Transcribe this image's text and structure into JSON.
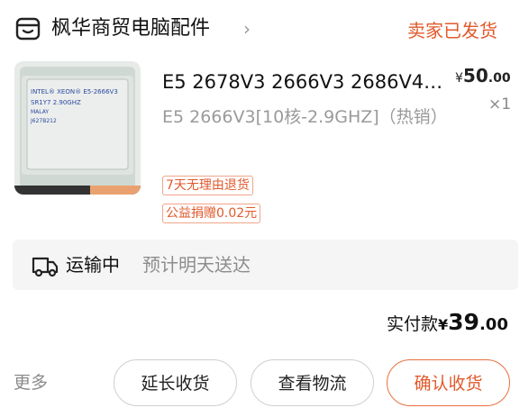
{
  "header": {
    "store_icon": "store-icon",
    "store_name": "枫华商贸电脑配件",
    "chevron_icon": "chevron-right-icon",
    "order_status": "卖家已发货"
  },
  "product": {
    "image_alt": "Intel Xeon E5-2666V3 CPU",
    "chip_text": {
      "brand": "INTEL® XEON® E5-2666V3",
      "line2": "SR1Y7 2.90GHZ",
      "line3": "MALAY",
      "line4": "J627B212"
    },
    "title": "E5 2678V3 2666V3 2686V4…",
    "price_currency": "¥",
    "price_integer": "50",
    "price_decimal": ".00",
    "quantity": "×1",
    "spec": "E5 2666V3[10核-2.9GHZ]（热销）",
    "tags": [
      "7天无理由退货",
      "公益捐赠0.02元"
    ]
  },
  "shipping": {
    "icon": "truck-icon",
    "status": "运输中",
    "eta": "预计明天送达"
  },
  "total": {
    "label": "实付款",
    "currency": "¥",
    "integer": "39",
    "decimal": ".00"
  },
  "actions": {
    "more": "更多",
    "extend": "延长收货",
    "track": "查看物流",
    "confirm": "确认收货"
  },
  "colors": {
    "accent": "#e2592b",
    "muted": "#8d8d8d",
    "panel": "#f5f5f5"
  }
}
